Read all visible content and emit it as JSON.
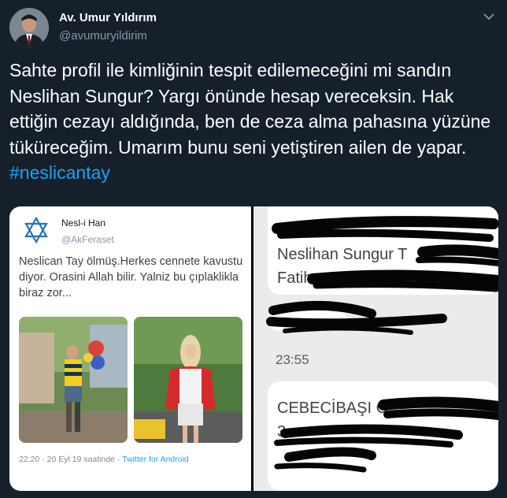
{
  "author": {
    "name": "Av. Umur Yıldırım",
    "handle": "@avumuryildirim",
    "avatar_icon": "person-avatar-icon"
  },
  "menu": {
    "caret_icon": "chevron-down-icon"
  },
  "tweet": {
    "text": "Sahte profil ile kimliğinin tespit edilemeceğini mi sandın Neslihan Sungur? Yargı önünde hesap vereceksin. Hak ettiğin cezayı aldığında, ben de ceza alma pahasına yüzüne tüküreceğim. Umarım bunu seni yetiştiren ailen de yapar. ",
    "hashtag": "#neslicantay"
  },
  "embedded_tweet": {
    "name": "Nesl-i Han",
    "handle": "@AkFeraset",
    "text": "Neslican Tay ölmüş.Herkes cennete kavustu diyor. Orasini Allah bilir. Yalniz bu çıplaklikla biraz zor...",
    "timestamp": "22:20 · 20 Eyl 19 saatinde · ",
    "source": "Twitter for Android"
  },
  "sms": {
    "line1": "Neslihan Sungur T",
    "line2": "Fatih",
    "time": "23:55",
    "line3": "CEBECİBAŞI C",
    "line4": "3"
  },
  "colors": {
    "background": "#15202b",
    "text": "#ffffff",
    "secondary": "#8899a6",
    "link": "#1da1f2"
  }
}
